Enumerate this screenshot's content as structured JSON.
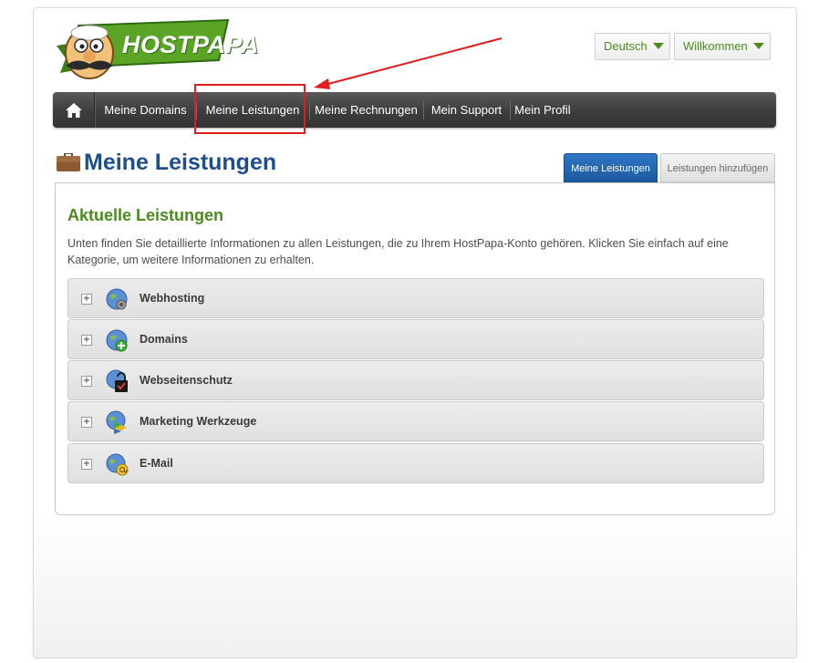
{
  "header": {
    "logo_text": "HOSTPAPA",
    "language_label": "Deutsch",
    "welcome_label": "Willkommen"
  },
  "nav": {
    "home_icon": "home-icon",
    "items": [
      {
        "label": "Meine Domains"
      },
      {
        "label": "Meine Leistungen"
      },
      {
        "label": "Meine Rechnungen"
      },
      {
        "label": "Mein Support"
      },
      {
        "label": "Mein Profil"
      }
    ],
    "active_index": 1
  },
  "page": {
    "title": "Meine Leistungen",
    "title_icon": "briefcase-icon"
  },
  "tabs": {
    "active_label": "Meine Leistungen",
    "add_label": "Leistungen hinzufügen"
  },
  "content": {
    "section_title": "Aktuelle Leistungen",
    "intro": "Unten finden Sie detaillierte Informationen zu allen Leistungen, die zu Ihrem HostPapa-Konto gehören. Klicken Sie einfach auf eine Kategorie, um weitere Informationen zu erhalten.",
    "categories": [
      {
        "label": "Webhosting",
        "icon": "globe-icon"
      },
      {
        "label": "Domains",
        "icon": "globe-add-icon"
      },
      {
        "label": "Webseitenschutz",
        "icon": "globe-lock-icon"
      },
      {
        "label": "Marketing Werkzeuge",
        "icon": "globe-marketing-icon"
      },
      {
        "label": "E-Mail",
        "icon": "globe-email-icon"
      }
    ]
  },
  "colors": {
    "brand_green": "#4a8d1c",
    "title_blue": "#1f4e8c",
    "tab_blue": "#1b5aa0",
    "nav_dark": "#3f3f3f",
    "annotation_red": "#e21d1d"
  }
}
